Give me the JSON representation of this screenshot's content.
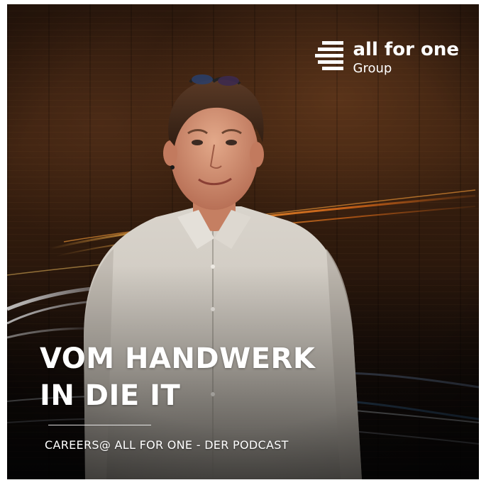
{
  "logo": {
    "name": "all for one",
    "sub": "Group",
    "icon": "stacked-bars-logo-icon"
  },
  "headline": {
    "line1": "VOM HANDWERK",
    "line2": "IN DIE IT"
  },
  "subline": "CAREERS@ ALL FOR ONE - DER PODCAST",
  "colors": {
    "text": "#ffffff",
    "background_dark": "#1b0f08",
    "wood": "#3a200f",
    "streak": "#ff9a2e"
  }
}
